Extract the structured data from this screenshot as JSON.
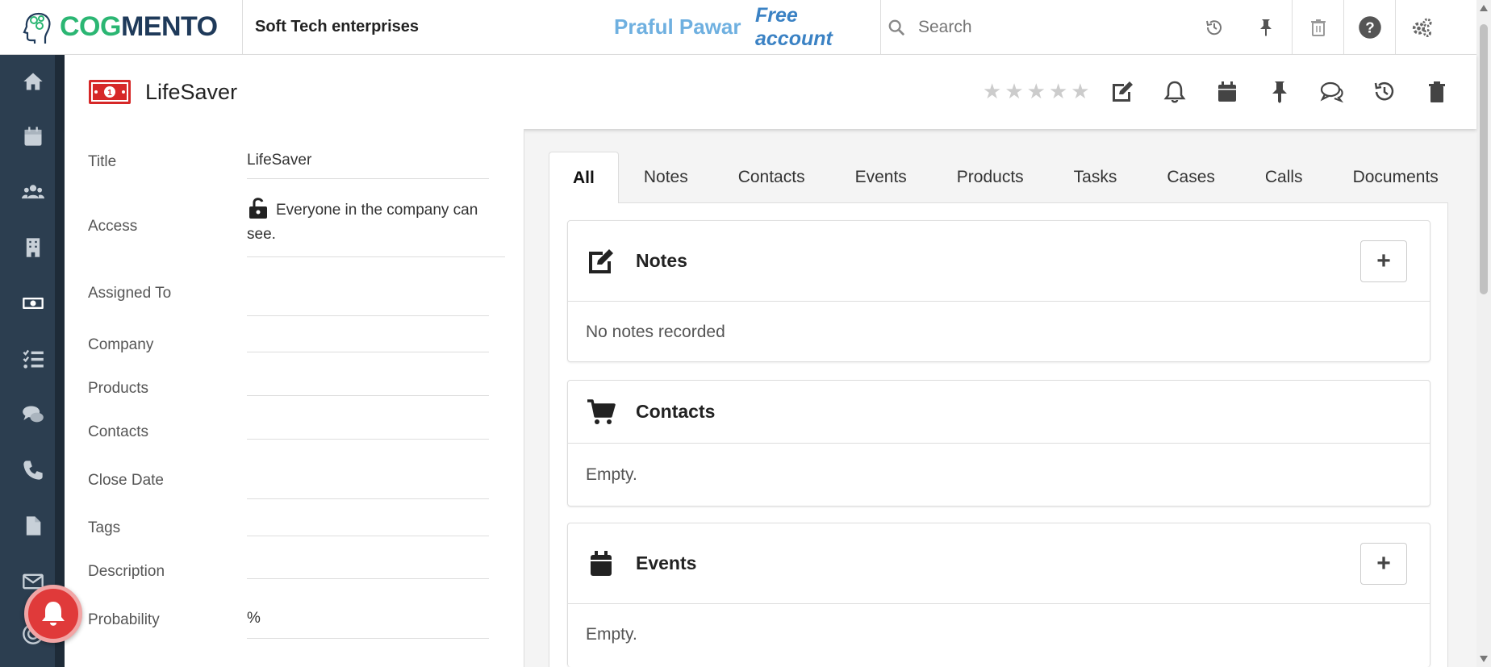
{
  "brand": {
    "logo_cog": "COG",
    "logo_mento": "MENTO"
  },
  "topbar": {
    "company": "Soft Tech enterprises",
    "user": "Praful Pawar",
    "account": "Free account",
    "search_placeholder": "Search",
    "icons": [
      "history-icon",
      "pin-icon",
      "trash-icon",
      "help-icon",
      "settings-icon"
    ]
  },
  "sidebar": {
    "items": [
      "home-icon",
      "calendar-icon",
      "contacts-icon",
      "companies-icon",
      "deals-icon",
      "tasks-icon",
      "cases-icon",
      "calls-icon",
      "documents-icon",
      "email-icon",
      "campaigns-icon"
    ]
  },
  "record": {
    "title": "LifeSaver",
    "rating": 0,
    "rating_max": 5,
    "actions": [
      "edit-icon",
      "bell-icon",
      "calendar-icon",
      "pin-icon",
      "comments-icon",
      "history-icon",
      "trash-icon"
    ]
  },
  "fields": {
    "title_label": "Title",
    "title_value": "LifeSaver",
    "access_label": "Access",
    "access_value": "Everyone in the company can see.",
    "assigned_label": "Assigned To",
    "assigned_value": "",
    "company_label": "Company",
    "company_value": "",
    "products_label": "Products",
    "products_value": "",
    "contacts_label": "Contacts",
    "contacts_value": "",
    "close_date_label": "Close Date",
    "close_date_value": "",
    "tags_label": "Tags",
    "tags_value": "",
    "description_label": "Description",
    "description_value": "",
    "probability_label": "Probability",
    "probability_value": "%"
  },
  "tabs": [
    "All",
    "Notes",
    "Contacts",
    "Events",
    "Products",
    "Tasks",
    "Cases",
    "Calls",
    "Documents"
  ],
  "active_tab": "All",
  "cards": {
    "notes": {
      "title": "Notes",
      "body": "No notes recorded",
      "add": "+"
    },
    "contacts": {
      "title": "Contacts",
      "body": "Empty."
    },
    "events": {
      "title": "Events",
      "body": "Empty.",
      "add": "+"
    }
  },
  "colors": {
    "sidebar": "#2c3e50",
    "brand_green": "#2bb673",
    "brand_navy": "#1f3a5a",
    "user": "#6fb0e0",
    "account": "#3b82c4",
    "notif": "#e03a3a"
  }
}
